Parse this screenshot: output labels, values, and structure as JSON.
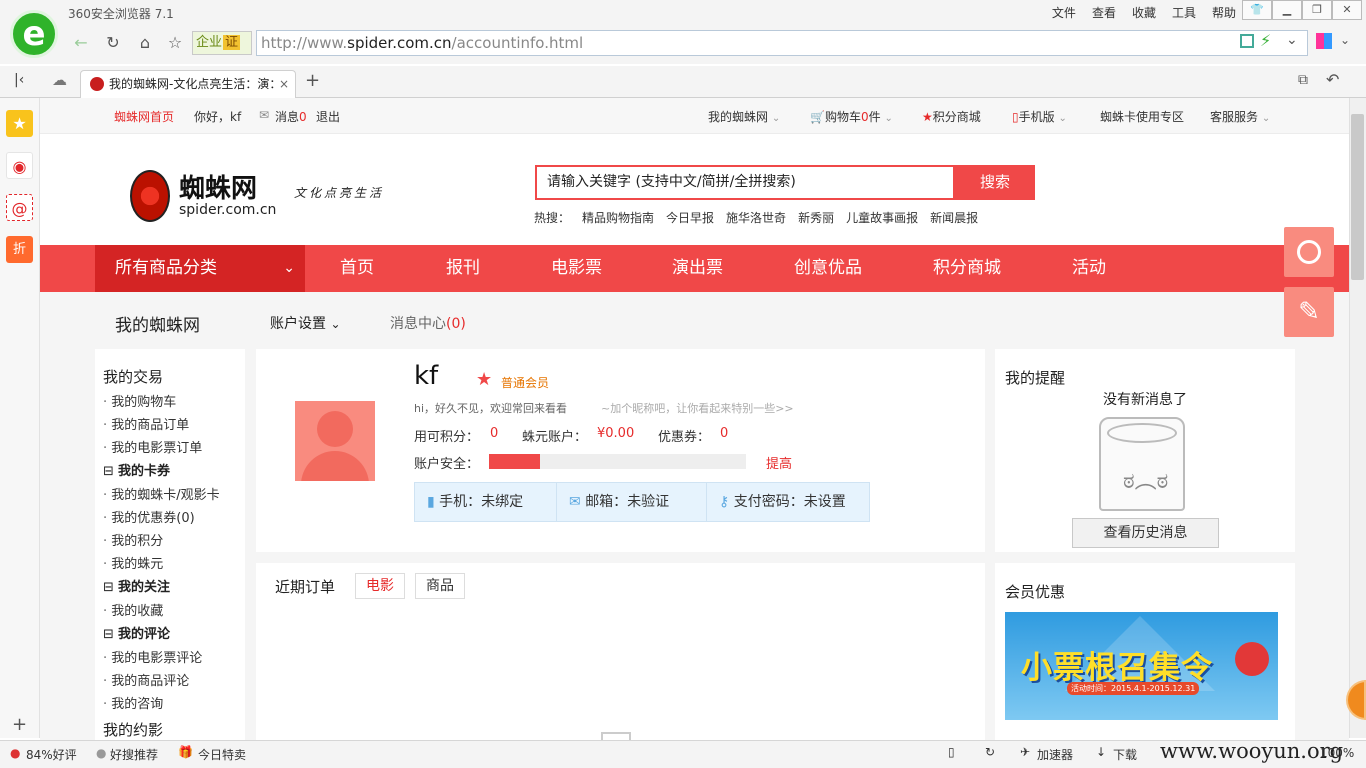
{
  "browser": {
    "title": "360安全浏览器 7.1",
    "menu": [
      "文件",
      "查看",
      "收藏",
      "工具",
      "帮助"
    ],
    "url_prefix": "http://www.",
    "url_host": "spider.com.cn",
    "url_path": "/accountinfo.html",
    "enterprise_badge": "企业",
    "cert_badge": "证",
    "tab_title": "我的蜘蛛网-文化点亮生活：演：",
    "status": {
      "rating": "84%好评",
      "recommend": "好搜推荐",
      "daily": "今日特卖",
      "accelerator": "加速器",
      "download": "下载",
      "zoom": "100%"
    },
    "watermark": "www.wooyun.org"
  },
  "topnav": {
    "home": "蜘蛛网首页",
    "greeting": "你好，kf",
    "messages": "消息",
    "messages_count": "0",
    "logout": "退出",
    "my_spider": "我的蜘蛛网",
    "cart": "购物车",
    "cart_count": "0",
    "cart_unit": "件",
    "points_mall": "积分商城",
    "mobile": "手机版",
    "card_zone": "蜘蛛卡使用专区",
    "service": "客服服务"
  },
  "header": {
    "brand": "蜘蛛网",
    "domain": "spider.com.cn",
    "slogan": "文化点亮生活",
    "search_placeholder": "请输入关键字 (支持中文/简拼/全拼搜索)",
    "search_button": "搜索",
    "hot_label": "热搜：",
    "hot_words": [
      "精品购物指南",
      "今日早报",
      "施华洛世奇",
      "新秀丽",
      "儿童故事画报",
      "新闻晨报"
    ]
  },
  "mainnav": {
    "all_categories": "所有商品分类",
    "items": [
      "首页",
      "报刊",
      "电影票",
      "演出票",
      "创意优品",
      "积分商城",
      "活动"
    ]
  },
  "subnav": {
    "title": "我的蜘蛛网",
    "account_settings": "账户设置",
    "message_center": "消息中心",
    "message_count": "(0)"
  },
  "sidebar": {
    "sections": [
      {
        "type": "h",
        "label": "我的交易"
      },
      {
        "type": "a",
        "label": "我的购物车"
      },
      {
        "type": "a",
        "label": "我的商品订单"
      },
      {
        "type": "a",
        "label": "我的电影票订单"
      },
      {
        "type": "g",
        "label": "我的卡券"
      },
      {
        "type": "a",
        "label": "我的蜘蛛卡/观影卡"
      },
      {
        "type": "a",
        "label": "我的优惠券(0)"
      },
      {
        "type": "a",
        "label": "我的积分"
      },
      {
        "type": "a",
        "label": "我的蛛元"
      },
      {
        "type": "g",
        "label": "我的关注"
      },
      {
        "type": "a",
        "label": "我的收藏"
      },
      {
        "type": "g",
        "label": "我的评论"
      },
      {
        "type": "a",
        "label": "我的电影票评论"
      },
      {
        "type": "a",
        "label": "我的商品评论"
      },
      {
        "type": "a",
        "label": "我的咨询"
      },
      {
        "type": "h",
        "label": "我的约影"
      }
    ]
  },
  "profile": {
    "username": "kf",
    "member_level": "普通会员",
    "welcome": "hi，好久不见，欢迎常回来看看",
    "nickname_hint": "~加个昵称吧，让你看起来特别一些>>",
    "points_label": "用可积分：",
    "points": "0",
    "coins_label": "蛛元账户：",
    "coins": "¥0.00",
    "coupons_label": "优惠券：",
    "coupons": "0",
    "security_label": "账户安全：",
    "security_level": 0.2,
    "improve": "提高",
    "phone": "手机：未绑定",
    "email": "邮箱：未验证",
    "paypass": "支付密码：未设置"
  },
  "reminders": {
    "title": "我的提醒",
    "empty": "没有新消息了",
    "history_button": "查看历史消息"
  },
  "orders": {
    "title": "近期订单",
    "tabs": [
      "电影",
      "商品"
    ]
  },
  "member": {
    "title": "会员优惠",
    "banner_text": "小票根召集令",
    "banner_date": "活动时间：2015.4.1-2015.12.31"
  },
  "colors": {
    "brand_red": "#f04848",
    "dark_red": "#d42424",
    "link_red": "#e62b2b"
  }
}
